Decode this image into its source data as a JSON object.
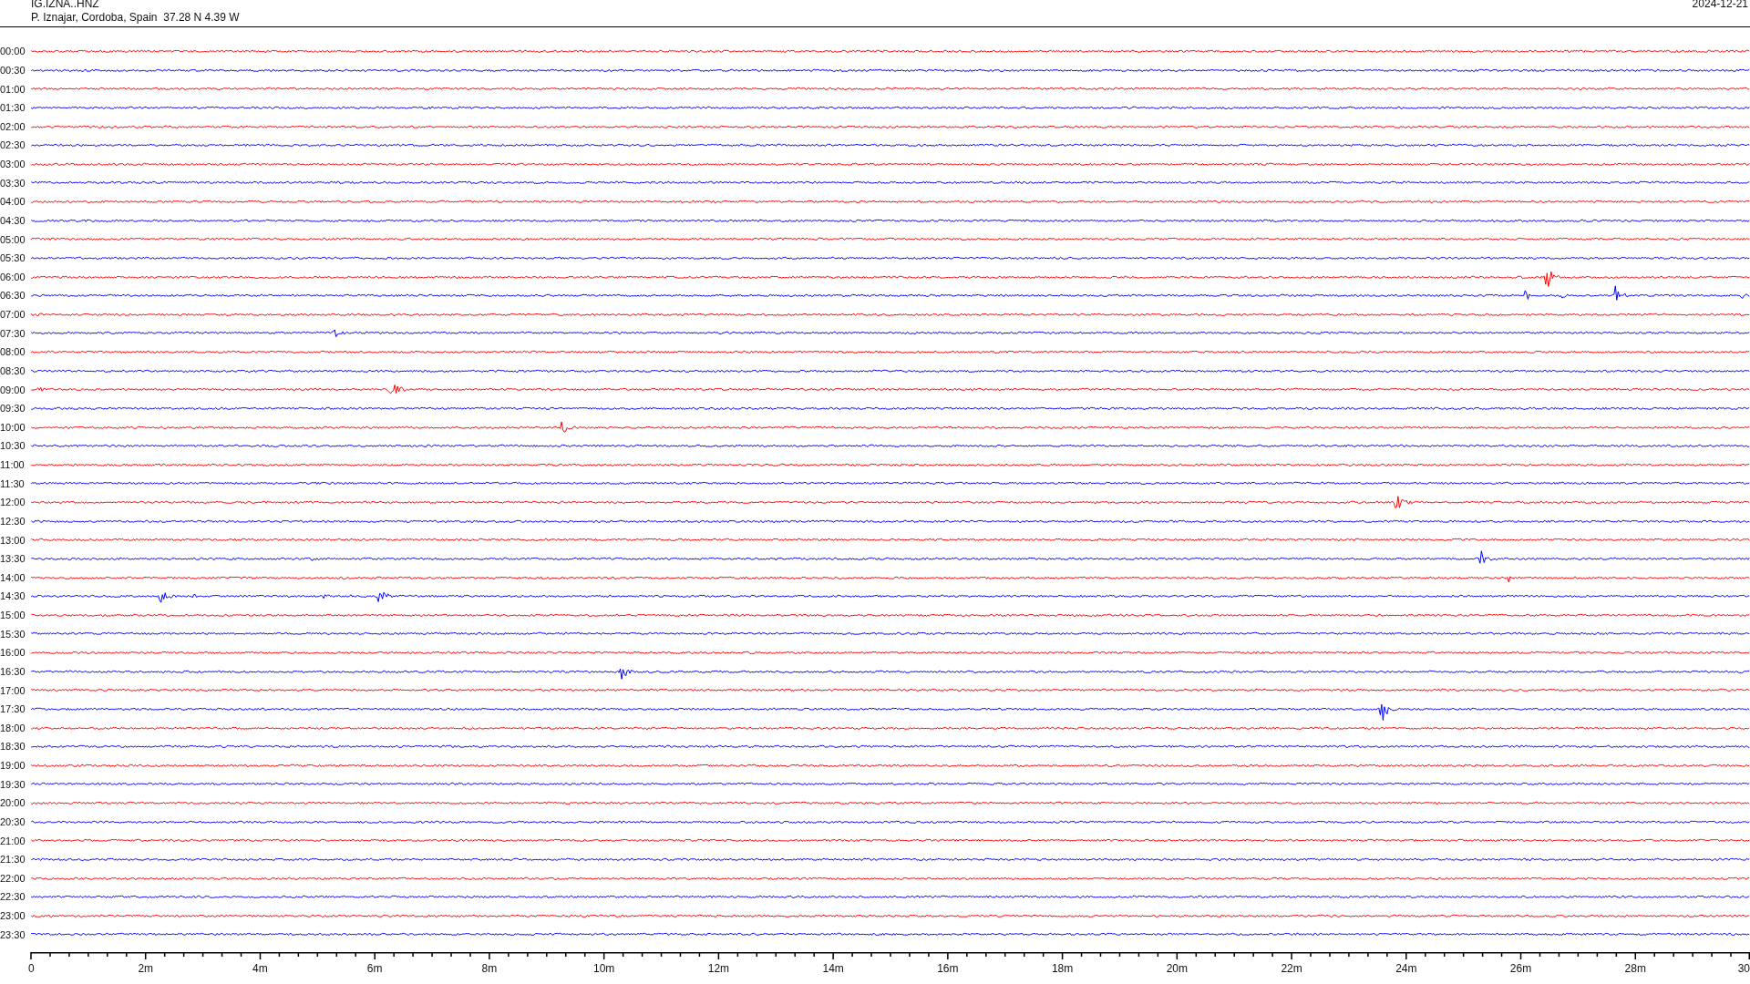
{
  "header": {
    "station": "IG.IZNA..HNZ",
    "location": "P. Iznajar, Cordoba, Spain  37.28 N 4.39 W",
    "date": "2024-12-21"
  },
  "rows": [
    {
      "time": "00:00",
      "color": "#ff0000"
    },
    {
      "time": "00:30",
      "color": "#0000ff"
    },
    {
      "time": "01:00",
      "color": "#ff0000"
    },
    {
      "time": "01:30",
      "color": "#0000ff"
    },
    {
      "time": "02:00",
      "color": "#ff0000"
    },
    {
      "time": "02:30",
      "color": "#0000ff"
    },
    {
      "time": "03:00",
      "color": "#ff0000"
    },
    {
      "time": "03:30",
      "color": "#0000ff"
    },
    {
      "time": "04:00",
      "color": "#ff0000"
    },
    {
      "time": "04:30",
      "color": "#0000ff"
    },
    {
      "time": "05:00",
      "color": "#ff0000"
    },
    {
      "time": "05:30",
      "color": "#0000ff"
    },
    {
      "time": "06:00",
      "color": "#ff0000"
    },
    {
      "time": "06:30",
      "color": "#0000ff"
    },
    {
      "time": "07:00",
      "color": "#ff0000"
    },
    {
      "time": "07:30",
      "color": "#0000ff"
    },
    {
      "time": "08:00",
      "color": "#ff0000"
    },
    {
      "time": "08:30",
      "color": "#0000ff"
    },
    {
      "time": "09:00",
      "color": "#ff0000"
    },
    {
      "time": "09:30",
      "color": "#0000ff"
    },
    {
      "time": "10:00",
      "color": "#ff0000"
    },
    {
      "time": "10:30",
      "color": "#0000ff"
    },
    {
      "time": "11:00",
      "color": "#ff0000"
    },
    {
      "time": "11:30",
      "color": "#0000ff"
    },
    {
      "time": "12:00",
      "color": "#ff0000"
    },
    {
      "time": "12:30",
      "color": "#0000ff"
    },
    {
      "time": "13:00",
      "color": "#ff0000"
    },
    {
      "time": "13:30",
      "color": "#0000ff"
    },
    {
      "time": "14:00",
      "color": "#ff0000"
    },
    {
      "time": "14:30",
      "color": "#0000ff"
    },
    {
      "time": "15:00",
      "color": "#ff0000"
    },
    {
      "time": "15:30",
      "color": "#0000ff"
    },
    {
      "time": "16:00",
      "color": "#ff0000"
    },
    {
      "time": "16:30",
      "color": "#0000ff"
    },
    {
      "time": "17:00",
      "color": "#ff0000"
    },
    {
      "time": "17:30",
      "color": "#0000ff"
    },
    {
      "time": "18:00",
      "color": "#ff0000"
    },
    {
      "time": "18:30",
      "color": "#0000ff"
    },
    {
      "time": "19:00",
      "color": "#ff0000"
    },
    {
      "time": "19:30",
      "color": "#0000ff"
    },
    {
      "time": "20:00",
      "color": "#ff0000"
    },
    {
      "time": "20:30",
      "color": "#0000ff"
    },
    {
      "time": "21:00",
      "color": "#ff0000"
    },
    {
      "time": "21:30",
      "color": "#0000ff"
    },
    {
      "time": "22:00",
      "color": "#ff0000"
    },
    {
      "time": "22:30",
      "color": "#0000ff"
    },
    {
      "time": "23:00",
      "color": "#ff0000"
    },
    {
      "time": "23:30",
      "color": "#0000ff"
    }
  ],
  "x_axis": {
    "labels": [
      "0",
      "2m",
      "4m",
      "6m",
      "8m",
      "10m",
      "12m",
      "14m",
      "16m",
      "18m",
      "20m",
      "22m",
      "24m",
      "26m",
      "28m",
      "30"
    ]
  }
}
